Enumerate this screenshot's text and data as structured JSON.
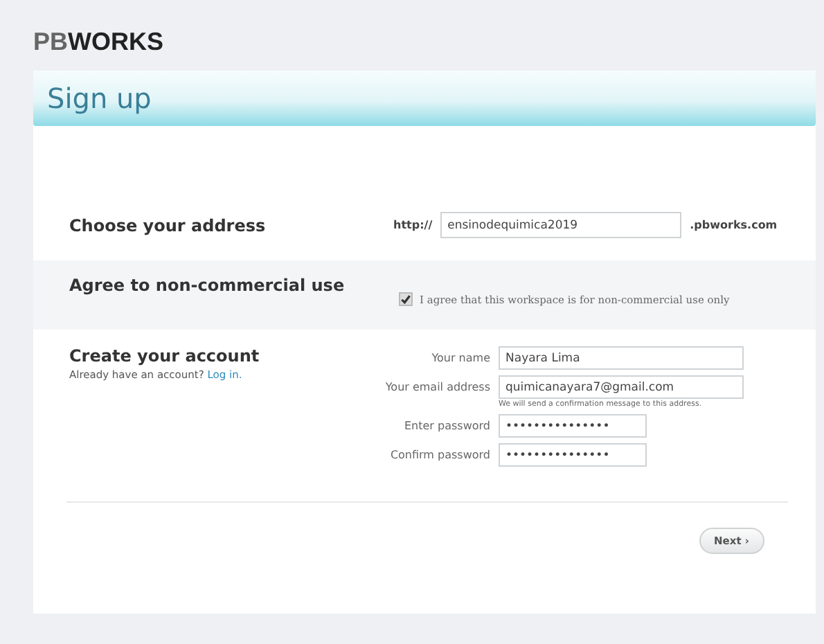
{
  "logo": {
    "dim": "PB",
    "bold": "WORKS"
  },
  "header": {
    "title": "Sign up"
  },
  "address": {
    "heading": "Choose your address",
    "prefix": "http://",
    "value": "ensinodequimica2019",
    "suffix": ".pbworks.com"
  },
  "agreement": {
    "heading": "Agree to non-commercial use",
    "checked": true,
    "label": "I agree that this workspace is for non-commercial use only"
  },
  "account": {
    "heading": "Create your account",
    "prompt": "Already have an account?",
    "link": "Log in.",
    "fields": [
      {
        "label": "Your name",
        "value": "Nayara Lima",
        "kind": "text"
      },
      {
        "label": "Your email address",
        "value": "quimicanayara7@gmail.com",
        "kind": "text",
        "hint": "We will send a confirmation message to this address."
      },
      {
        "label": "Enter password",
        "value": "•••••••••••••••",
        "kind": "password"
      },
      {
        "label": "Confirm password",
        "value": "•••••••••••••••",
        "kind": "password"
      }
    ]
  },
  "next_button": "Next ›"
}
